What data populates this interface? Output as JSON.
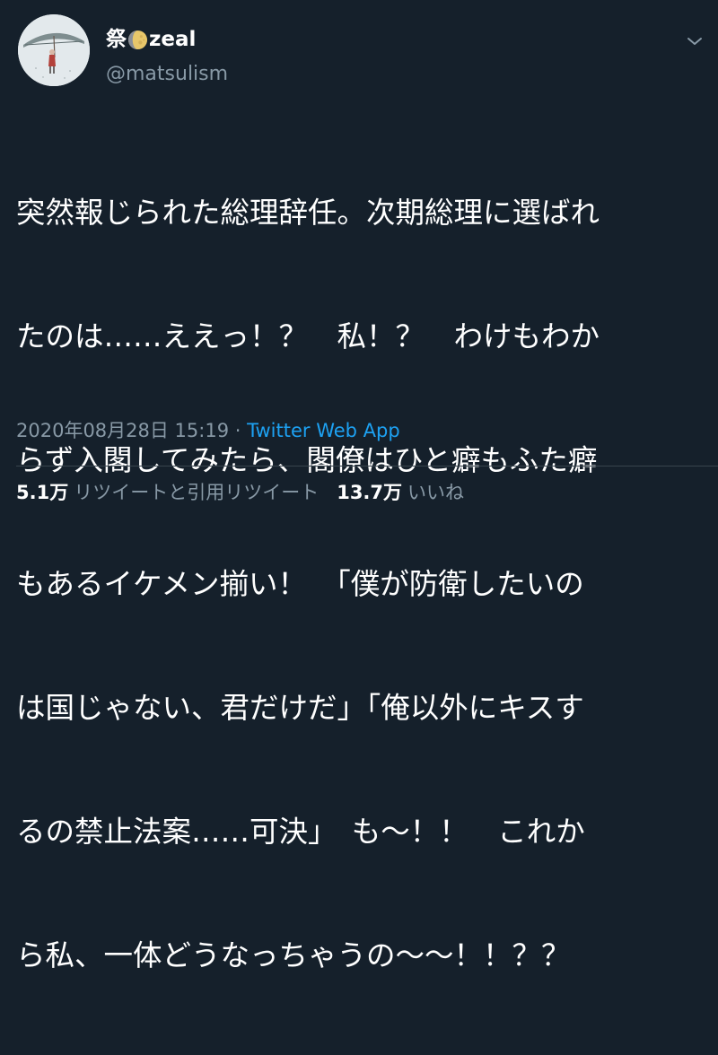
{
  "tweet": {
    "display_name_prefix": "祭",
    "display_name_suffix": "zeal",
    "moon_icon": "full-moon-emoji",
    "handle": "@matsulism",
    "text_lines": [
      "突然報じられた総理辞任。次期総理に選ばれ",
      "たのは……ええっ！？　私！？　わけもわか",
      "らず入閣してみたら、閣僚はひと癖もふた癖",
      "もあるイケメン揃い！　「僕が防衛したいの",
      "は国じゃない、君だけだ」「俺以外にキスす",
      "るの禁止法案……可決」　も〜！！　これか",
      "ら私、一体どうなっちゃうの〜〜！！？？"
    ],
    "date": "2020年08月28日 15:19",
    "separator": "·",
    "source": "Twitter Web App",
    "retweet_count": "5.1万",
    "retweet_label": "リツイートと引用リツイート",
    "like_count": "13.7万",
    "like_label": "いいね"
  },
  "colors": {
    "background": "#15202b",
    "primary_text": "#ffffff",
    "secondary_text": "#8899a6",
    "link": "#1da1f2",
    "divider": "#38444d"
  },
  "icons": {
    "caret": "chevron-down-icon",
    "avatar": "avatar-umbrella-figure"
  }
}
